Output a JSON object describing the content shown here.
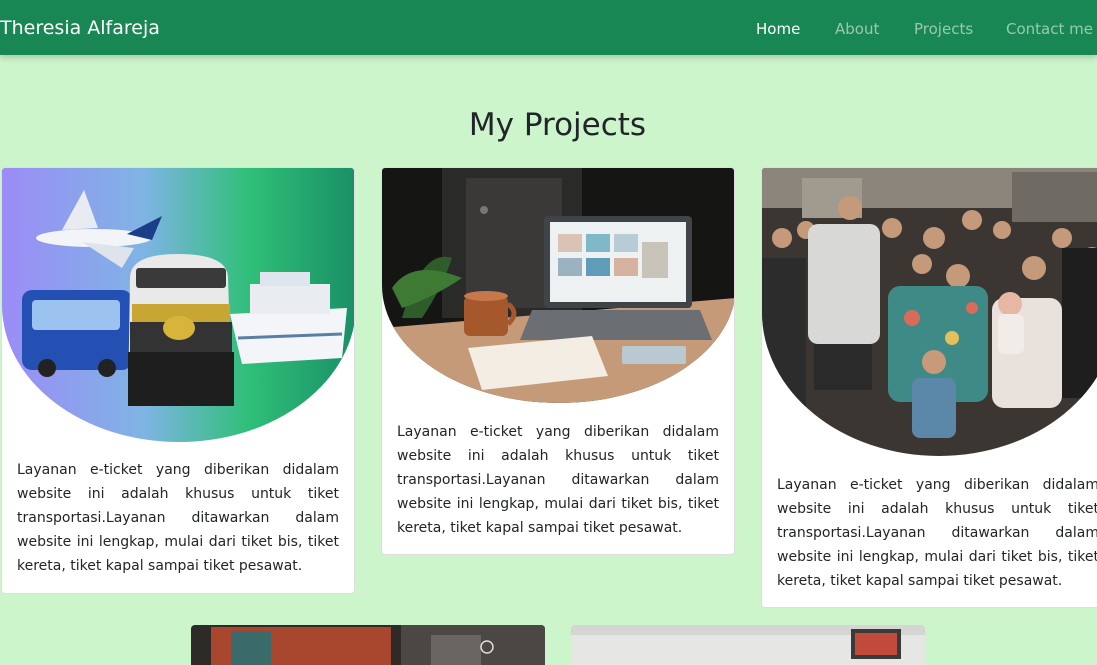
{
  "navbar": {
    "brand": "Theresia Alfareja",
    "links": [
      {
        "label": "Home",
        "active": true
      },
      {
        "label": "About",
        "active": false
      },
      {
        "label": "Projects",
        "active": false
      },
      {
        "label": "Contact me",
        "active": false
      }
    ]
  },
  "projects": {
    "title": "My Projects",
    "cards": [
      {
        "image": "transportation-collage-image",
        "text": "Layanan e-ticket yang diberikan didalam website ini adalah khusus untuk tiket transportasi.Layanan ditawarkan dalam website ini lengkap, mulai dari tiket bis, tiket kereta, tiket kapal sampai tiket pesawat."
      },
      {
        "image": "laptop-desk-image",
        "text": "Layanan e-ticket yang diberikan didalam website ini adalah khusus untuk tiket transportasi.Layanan ditawarkan dalam website ini lengkap, mulai dari tiket bis, tiket kereta, tiket kapal sampai tiket pesawat."
      },
      {
        "image": "street-crowd-image",
        "text": "Layanan e-ticket yang diberikan didalam website ini adalah khusus untuk tiket transportasi.Layanan ditawarkan dalam website ini lengkap, mulai dari tiket bis, tiket kereta, tiket kapal sampai tiket pesawat."
      }
    ]
  },
  "colors": {
    "navbar": "#198754",
    "page_background": "#cdf5cc",
    "nav_active": "#ffffff",
    "nav_inactive": "rgba(255,255,255,0.55)"
  }
}
